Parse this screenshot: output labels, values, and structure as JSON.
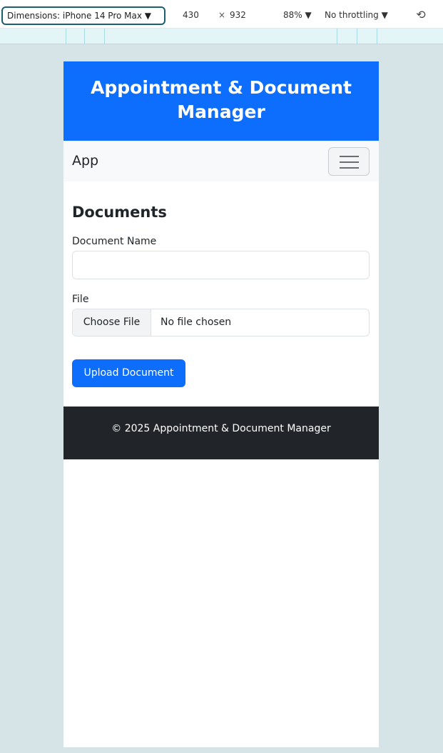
{
  "devtools": {
    "dimensions_label": "Dimensions: iPhone 14 Pro Max ▼",
    "width_value": "430",
    "times": "×",
    "height_value": "932",
    "zoom": "88% ▼",
    "throttling": "No throttling ▼",
    "rotate_icon": "rotate-icon"
  },
  "header": {
    "title": "Appointment & Document Manager"
  },
  "navbar": {
    "brand": "App",
    "toggler_icon": "hamburger-icon"
  },
  "documents": {
    "heading": "Documents",
    "name_label": "Document Name",
    "name_value": "",
    "file_label": "File",
    "file_button": "Choose File",
    "file_status": "No file chosen",
    "upload_button": "Upload Document"
  },
  "footer": {
    "text": "© 2025 Appointment & Document Manager"
  },
  "colors": {
    "primary": "#0d6efd",
    "footer_bg": "#212529",
    "navbar_bg": "#f8f9fa",
    "backdrop": "#d6e4e8"
  }
}
